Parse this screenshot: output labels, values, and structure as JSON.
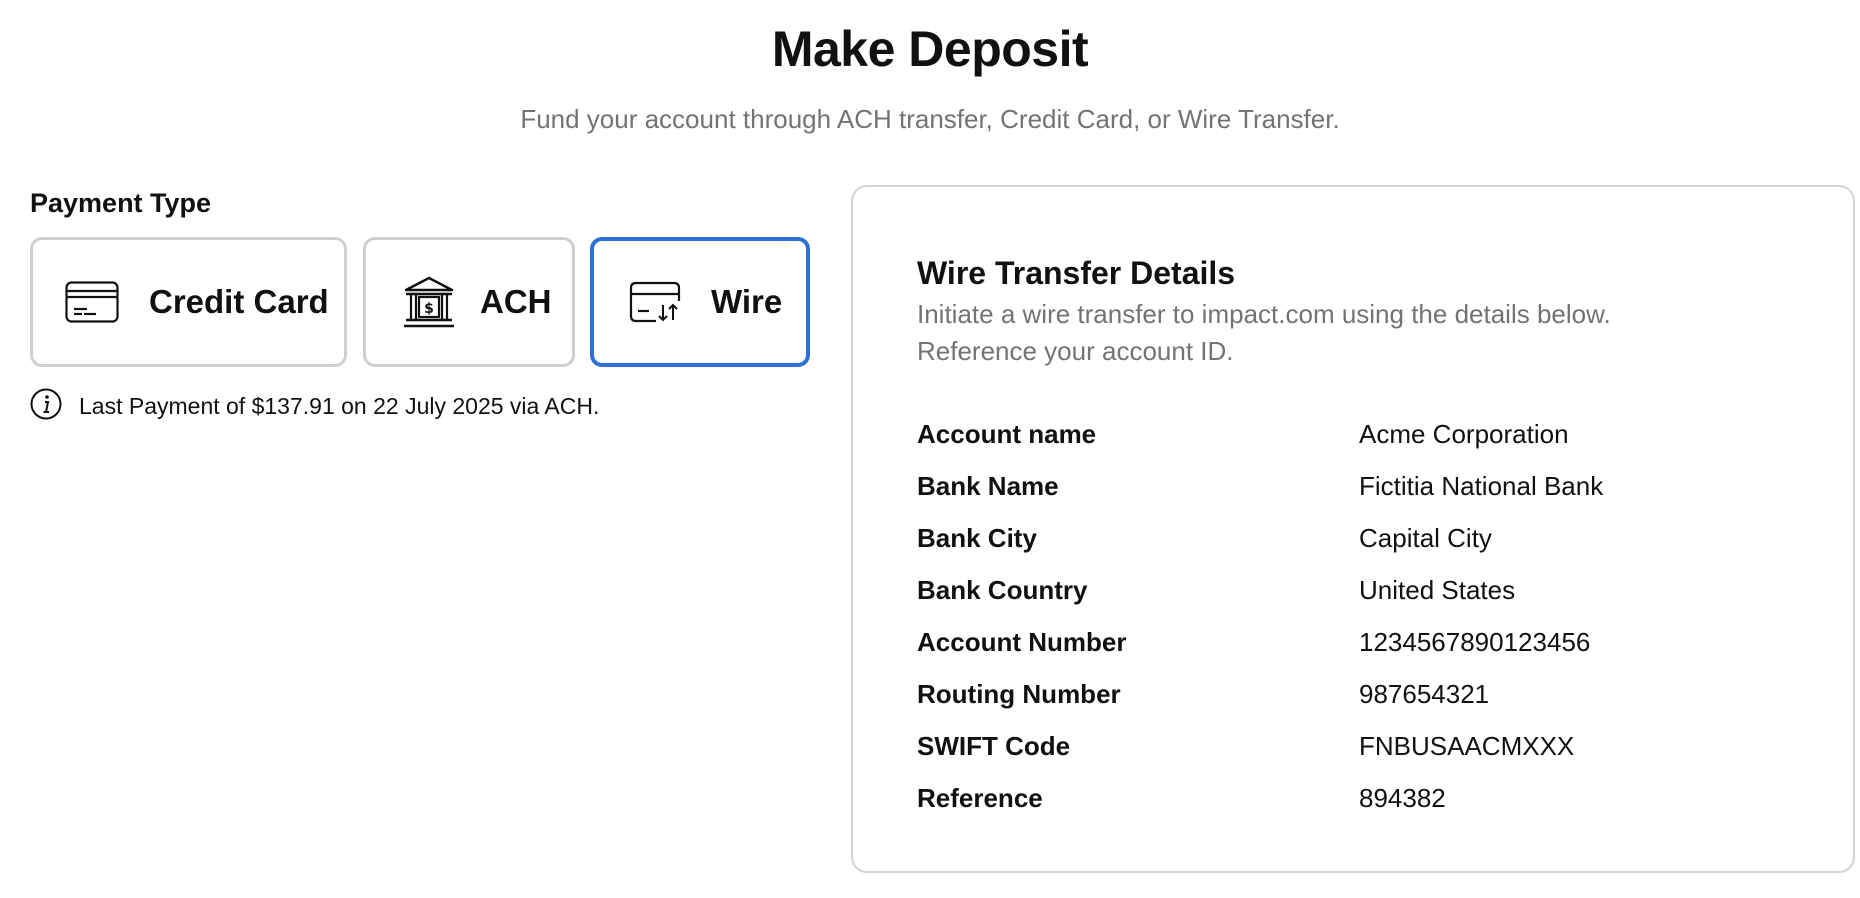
{
  "header": {
    "title": "Make Deposit",
    "subtitle": "Fund your account through ACH transfer, Credit Card, or Wire Transfer."
  },
  "payment_type": {
    "label": "Payment Type",
    "options": [
      {
        "label": "Credit Card",
        "icon": "credit-card-icon",
        "selected": false
      },
      {
        "label": "ACH",
        "icon": "bank-icon",
        "selected": false
      },
      {
        "label": "Wire",
        "icon": "wire-transfer-icon",
        "selected": true
      }
    ],
    "accent_color": "#2f6fd8"
  },
  "last_payment": {
    "icon": "info-icon",
    "text": "Last Payment of $137.91 on 22 July 2025 via ACH."
  },
  "wire_details": {
    "title": "Wire Transfer Details",
    "description": "Initiate a wire transfer to impact.com using the details below. Reference your account ID.",
    "rows": [
      {
        "label": "Account name",
        "value": "Acme Corporation"
      },
      {
        "label": "Bank Name",
        "value": "Fictitia National Bank"
      },
      {
        "label": "Bank City",
        "value": "Capital City"
      },
      {
        "label": "Bank Country",
        "value": "United States"
      },
      {
        "label": "Account Number",
        "value": "1234567890123456"
      },
      {
        "label": "Routing Number",
        "value": "987654321"
      },
      {
        "label": "SWIFT Code",
        "value": "FNBUSAACMXXX"
      },
      {
        "label": "Reference",
        "value": "894382"
      }
    ]
  }
}
